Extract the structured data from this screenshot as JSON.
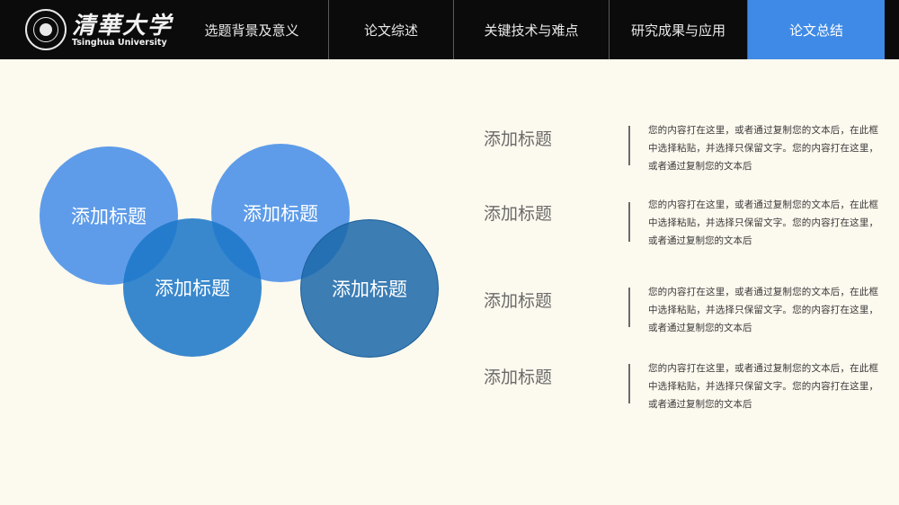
{
  "header": {
    "logo_cn": "清華大学",
    "logo_en": "Tsinghua University",
    "nav": [
      {
        "label": "选题背景及意义",
        "active": false
      },
      {
        "label": "论文综述",
        "active": false
      },
      {
        "label": "关键技术与难点",
        "active": false
      },
      {
        "label": "研究成果与应用",
        "active": false
      },
      {
        "label": "论文总结",
        "active": true
      }
    ]
  },
  "circles": [
    {
      "label": "添加标题"
    },
    {
      "label": "添加标题"
    },
    {
      "label": "添加标题"
    },
    {
      "label": "添加标题"
    }
  ],
  "items": [
    {
      "title": "添加标题",
      "text": "您的内容打在这里，或者通过复制您的文本后，在此框中选择粘贴，并选择只保留文字。您的内容打在这里，或者通过复制您的文本后"
    },
    {
      "title": "添加标题",
      "text": "您的内容打在这里，或者通过复制您的文本后，在此框中选择粘贴，并选择只保留文字。您的内容打在这里，或者通过复制您的文本后"
    },
    {
      "title": "添加标题",
      "text": "您的内容打在这里，或者通过复制您的文本后，在此框中选择粘贴，并选择只保留文字。您的内容打在这里，或者通过复制您的文本后"
    },
    {
      "title": "添加标题",
      "text": "您的内容打在这里，或者通过复制您的文本后，在此框中选择粘贴，并选择只保留文字。您的内容打在这里，或者通过复制您的文本后"
    }
  ],
  "colors": {
    "background": "#fcf9ee",
    "header": "#0b0b0b",
    "accent": "#3f8ae6"
  }
}
